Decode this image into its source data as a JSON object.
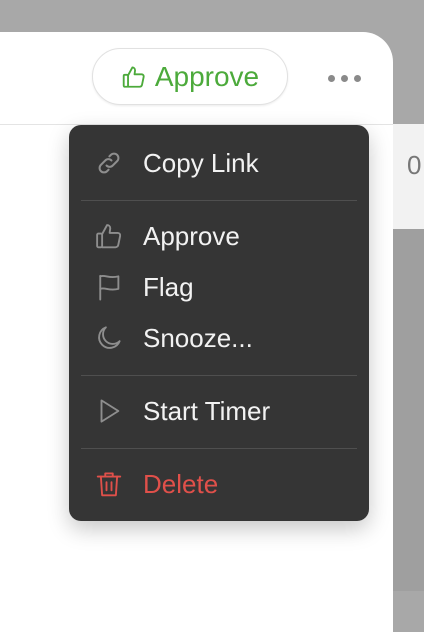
{
  "toolbar": {
    "approve_label": "Approve",
    "more_icon": "more-horizontal-icon"
  },
  "right_pane": {
    "peek_text": "0"
  },
  "menu": {
    "items": [
      {
        "label": "Copy Link",
        "icon": "link-icon"
      },
      {
        "label": "Approve",
        "icon": "thumbs-up-icon"
      },
      {
        "label": "Flag",
        "icon": "flag-icon"
      },
      {
        "label": "Snooze...",
        "icon": "moon-icon"
      },
      {
        "label": "Start Timer",
        "icon": "play-icon"
      },
      {
        "label": "Delete",
        "icon": "trash-icon"
      }
    ]
  },
  "colors": {
    "approve_green": "#4caa3b",
    "menu_bg": "#353535",
    "danger_red": "#e0504a"
  }
}
